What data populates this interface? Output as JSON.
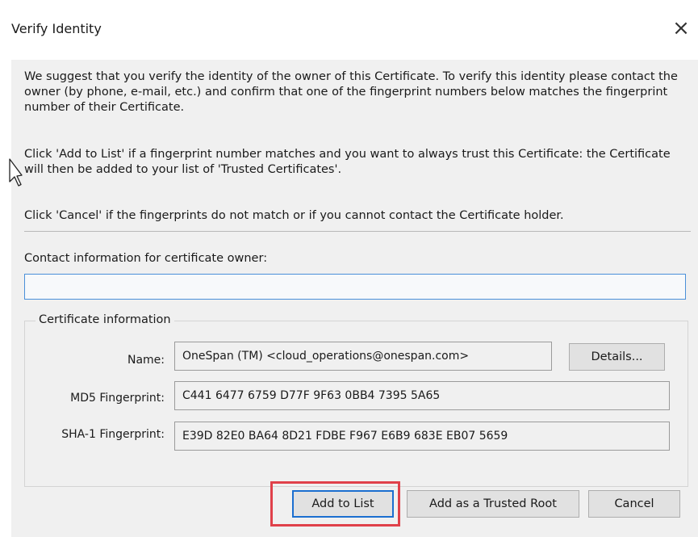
{
  "dialog": {
    "title": "Verify Identity",
    "close_icon": "close-icon"
  },
  "instructions": {
    "paragraph1": "We suggest that you verify the identity of the owner of this Certificate. To verify this identity please contact the owner (by phone, e-mail, etc.) and confirm that one of the fingerprint numbers below matches the fingerprint number of their Certificate.",
    "paragraph2": "Click 'Add to List' if a fingerprint number matches and you want to always trust this Certificate: the Certificate will then be added to your list of 'Trusted Certificates'.",
    "paragraph3": "Click 'Cancel' if the fingerprints do not match or if you cannot contact the Certificate holder."
  },
  "contact": {
    "label": "Contact information for certificate owner:",
    "value": "",
    "placeholder": ""
  },
  "certificate": {
    "group_label": "Certificate information",
    "name_label": "Name:",
    "name_value": "OneSpan (TM) <cloud_operations@onespan.com>",
    "details_button": "Details...",
    "md5_label": "MD5 Fingerprint:",
    "md5_value": "C441 6477 6759 D77F 9F63 0BB4 7395 5A65",
    "sha1_label": "SHA-1 Fingerprint:",
    "sha1_value": "E39D 82E0 BA64 8D21 FDBE F967 E6B9 683E EB07 5659"
  },
  "buttons": {
    "add_to_list": "Add to List",
    "add_trusted_root": "Add as a Trusted Root",
    "cancel": "Cancel"
  },
  "colors": {
    "highlight": "#e0414a",
    "focus_border": "#1b6fd0",
    "input_border": "#4a90d9",
    "dialog_background": "#f0f0f0"
  },
  "icons": {
    "close": "close-icon",
    "cursor": "mouse-pointer-icon"
  }
}
